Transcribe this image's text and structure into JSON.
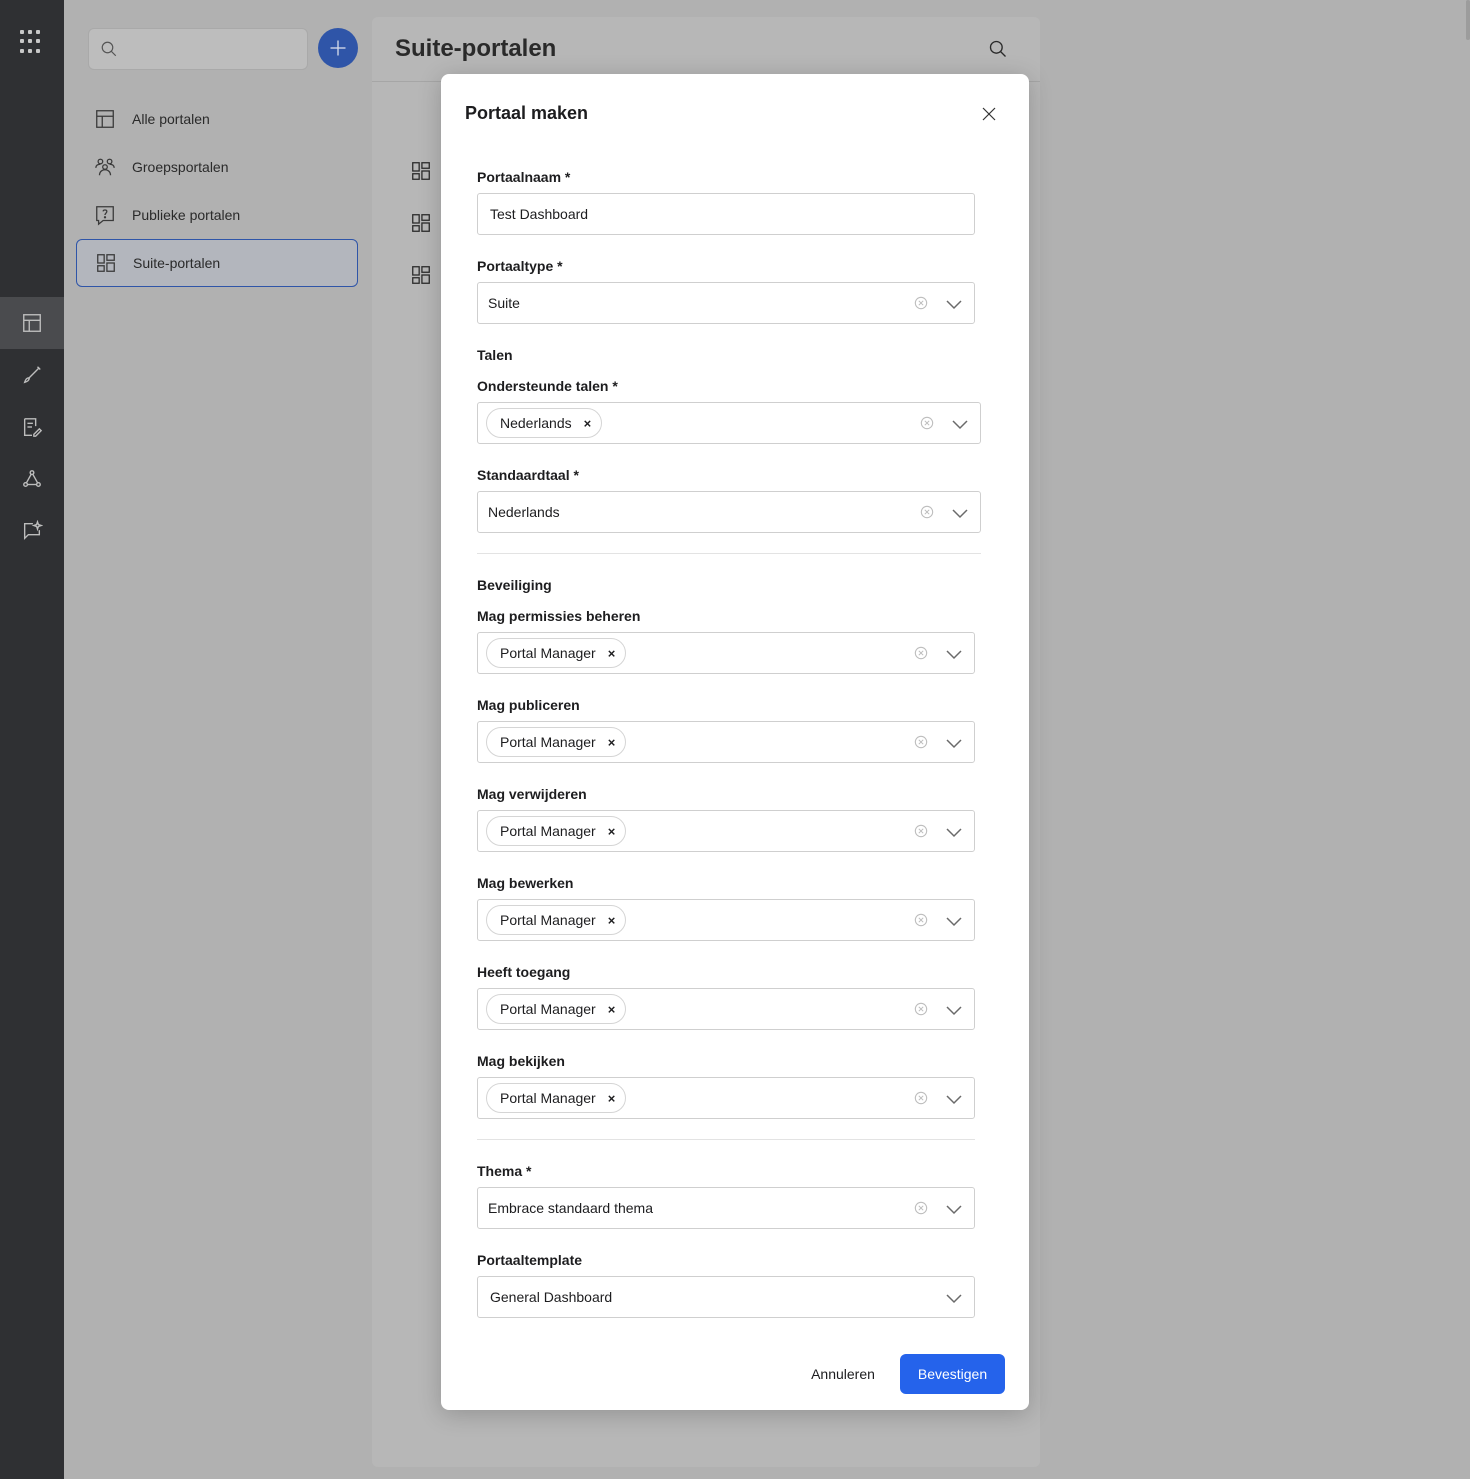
{
  "sidebar": {
    "items": [
      {
        "label": "Alle portalen",
        "icon": "table-icon"
      },
      {
        "label": "Groepsportalen",
        "icon": "group-icon"
      },
      {
        "label": "Publieke portalen",
        "icon": "public-help-icon"
      },
      {
        "label": "Suite-portalen",
        "icon": "dashboard-icon"
      }
    ]
  },
  "main": {
    "title": "Suite-portalen"
  },
  "modal": {
    "title": "Portaal maken",
    "portal_name": {
      "label": "Portaalnaam *",
      "value": "Test Dashboard"
    },
    "portal_type": {
      "label": "Portaaltype *",
      "value": "Suite"
    },
    "languages_section": "Talen",
    "supported_languages": {
      "label": "Ondersteunde talen *",
      "chips": [
        "Nederlands"
      ]
    },
    "default_language": {
      "label": "Standaardtaal *",
      "value": "Nederlands"
    },
    "security_section": "Beveiliging",
    "perm_manage": {
      "label": "Mag permissies beheren",
      "chips": [
        "Portal Manager"
      ]
    },
    "perm_publish": {
      "label": "Mag publiceren",
      "chips": [
        "Portal Manager"
      ]
    },
    "perm_delete": {
      "label": "Mag verwijderen",
      "chips": [
        "Portal Manager"
      ]
    },
    "perm_edit": {
      "label": "Mag bewerken",
      "chips": [
        "Portal Manager"
      ]
    },
    "perm_access": {
      "label": "Heeft toegang",
      "chips": [
        "Portal Manager"
      ]
    },
    "perm_view": {
      "label": "Mag bekijken",
      "chips": [
        "Portal Manager"
      ]
    },
    "theme": {
      "label": "Thema *",
      "value": "Embrace standaard thema"
    },
    "template": {
      "label": "Portaaltemplate",
      "value": "General Dashboard"
    },
    "cancel_label": "Annuleren",
    "confirm_label": "Bevestigen",
    "chip_remove_glyph": "×"
  },
  "colors": {
    "rail": "#2f3033",
    "accent": "#2563eb",
    "add_button": "#2f55a8",
    "overlay_bg": "#b1b1b1"
  }
}
